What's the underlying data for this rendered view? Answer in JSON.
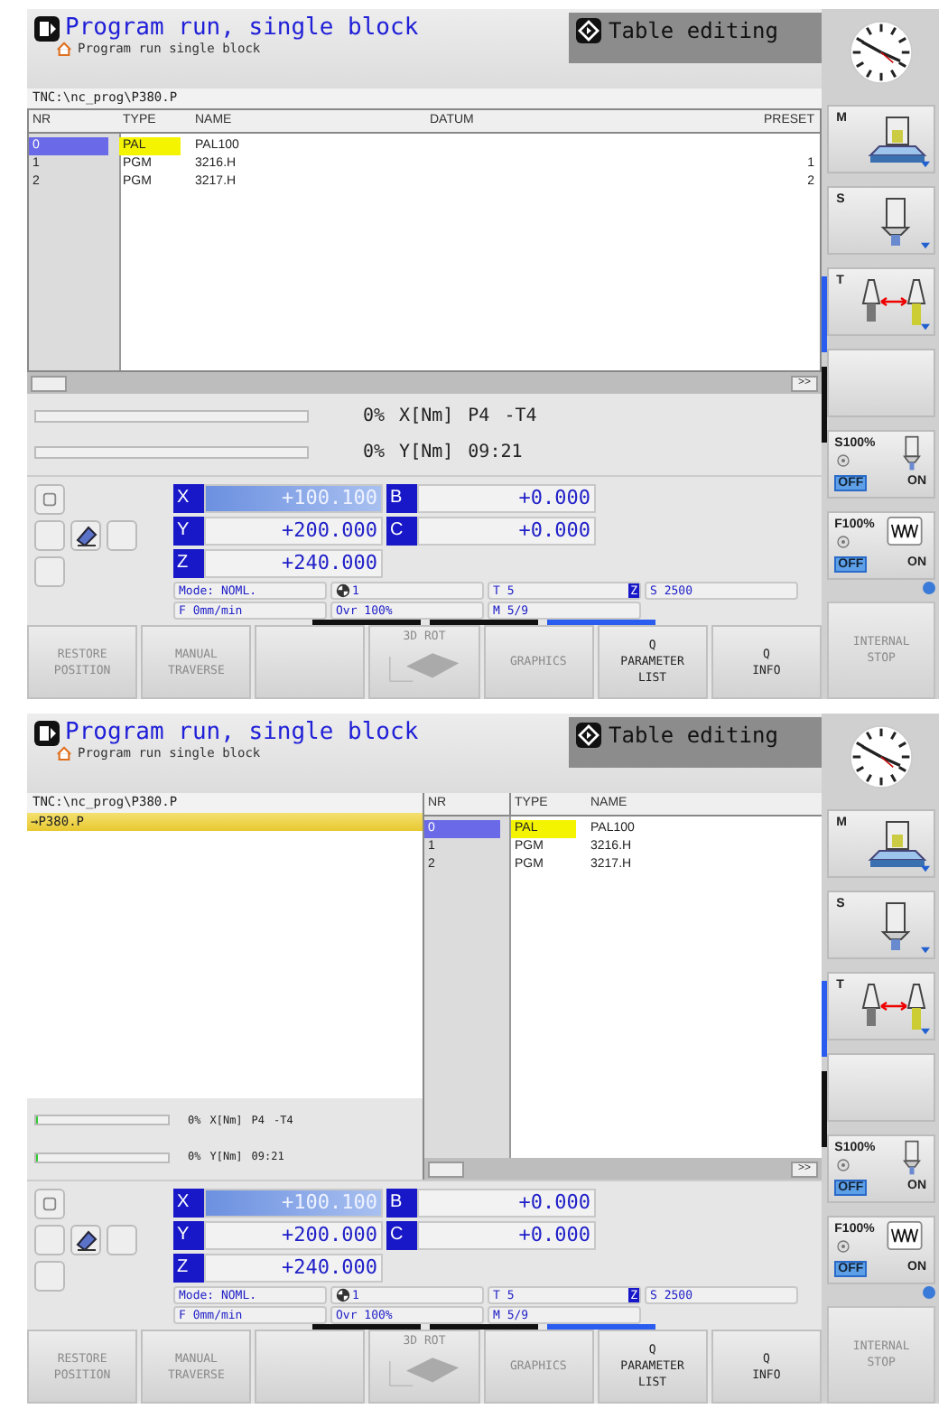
{
  "screens": [
    {
      "kind": "table",
      "header": {
        "title": "Program run, single block",
        "subtitle": "Program run single block",
        "other_mode": "Table editing"
      },
      "path": "TNC:\\nc_prog\\P380.P",
      "table": {
        "columns": [
          "NR",
          "TYPE",
          "NAME",
          "DATUM",
          "PRESET"
        ],
        "rows": [
          {
            "nr": "0",
            "type": "PAL",
            "name": "PAL100",
            "selected": true
          },
          {
            "nr": "1",
            "type": "PGM",
            "name": "3216.H",
            "preset": "1",
            "selected": false
          },
          {
            "nr": "2",
            "type": "PGM",
            "name": "3217.H",
            "preset": "2",
            "selected": false
          }
        ]
      },
      "scroll_button": ">>",
      "meters": [
        {
          "level": 0,
          "texts": [
            "0%",
            "X[Nm]",
            "P4",
            "-T4"
          ]
        },
        {
          "level": 0,
          "texts": [
            "0%",
            "Y[Nm]",
            "09:21"
          ]
        }
      ],
      "axes": [
        {
          "axis": "X",
          "value": "+100.100",
          "selected": true
        },
        {
          "axis": "B",
          "value": "+0.000",
          "selected": false
        },
        {
          "axis": "Y",
          "value": "+200.000",
          "selected": false
        },
        {
          "axis": "C",
          "value": "+0.000",
          "selected": false
        },
        {
          "axis": "Z",
          "value": "+240.000",
          "selected": false
        }
      ],
      "status": {
        "mode": "Mode: NOML.",
        "datum": "1",
        "tool": "T 5",
        "tool_axis": "Z",
        "spindle": "S 2500",
        "feed": "F 0mm/min",
        "override": "Ovr 100%",
        "mfunc": "M 5/9"
      },
      "softkey_pages": [
        {
          "selected": false
        },
        {
          "selected": false
        },
        {
          "selected": true
        }
      ],
      "softkeys": [
        {
          "kind": "text",
          "lines": [
            "RESTORE",
            "POSITION"
          ],
          "disabled": true
        },
        {
          "kind": "text",
          "lines": [
            "MANUAL",
            "TRAVERSE"
          ],
          "disabled": true
        },
        {
          "kind": "blank"
        },
        {
          "kind": "icon",
          "lines": [
            "3D ROT"
          ],
          "disabled": true
        },
        {
          "kind": "text",
          "lines": [
            "GRAPHICS"
          ],
          "disabled": true
        },
        {
          "kind": "text",
          "lines": [
            "Q",
            "PARAMETER",
            "LIST"
          ],
          "disabled": false
        },
        {
          "kind": "text",
          "lines": [
            "Q",
            "INFO"
          ],
          "disabled": false
        }
      ],
      "sidebar": {
        "pages": [
          {
            "selected": true
          },
          {
            "selected": false
          }
        ],
        "buttons": [
          {
            "kind": "machine",
            "letter": "M"
          },
          {
            "kind": "spindle",
            "letter": "S"
          },
          {
            "kind": "tool",
            "letter": "T"
          },
          {
            "kind": "blank"
          }
        ],
        "overrides": [
          {
            "kind": "spindle",
            "label": "S100%",
            "options": [
              {
                "label": "OFF",
                "selected": true
              },
              {
                "label": "ON",
                "selected": false
              }
            ]
          },
          {
            "kind": "feed",
            "label": "F100%",
            "options": [
              {
                "label": "OFF",
                "selected": true
              },
              {
                "label": "ON",
                "selected": false
              }
            ]
          }
        ],
        "stop": {
          "lines": [
            "INTERNAL",
            "STOP"
          ],
          "disabled": true
        }
      }
    },
    {
      "kind": "split",
      "header": {
        "title": "Program run, single block",
        "subtitle": "Program run single block",
        "other_mode": "Table editing"
      },
      "path": "TNC:\\nc_prog\\P380.P",
      "tree": [
        {
          "label": "→P380.P",
          "selected": true
        }
      ],
      "table": {
        "columns": [
          "NR",
          "TYPE",
          "NAME"
        ],
        "rows": [
          {
            "nr": "0",
            "type": "PAL",
            "name": "PAL100",
            "selected": true
          },
          {
            "nr": "1",
            "type": "PGM",
            "name": "3216.H",
            "selected": false
          },
          {
            "nr": "2",
            "type": "PGM",
            "name": "3217.H",
            "selected": false
          }
        ]
      },
      "scroll_button": ">>",
      "meters": [
        {
          "level": 0.02,
          "texts": [
            "0%",
            "X[Nm]",
            "P4",
            "-T4"
          ]
        },
        {
          "level": 0.02,
          "texts": [
            "0%",
            "Y[Nm]",
            "09:21"
          ]
        }
      ],
      "axes": [
        {
          "axis": "X",
          "value": "+100.100",
          "selected": true
        },
        {
          "axis": "B",
          "value": "+0.000",
          "selected": false
        },
        {
          "axis": "Y",
          "value": "+200.000",
          "selected": false
        },
        {
          "axis": "C",
          "value": "+0.000",
          "selected": false
        },
        {
          "axis": "Z",
          "value": "+240.000",
          "selected": false
        }
      ],
      "status": {
        "mode": "Mode: NOML.",
        "datum": "1",
        "tool": "T 5",
        "tool_axis": "Z",
        "spindle": "S 2500",
        "feed": "F 0mm/min",
        "override": "Ovr 100%",
        "mfunc": "M 5/9"
      },
      "softkey_pages": [
        {
          "selected": false
        },
        {
          "selected": false
        },
        {
          "selected": true
        }
      ],
      "softkeys": [
        {
          "kind": "text",
          "lines": [
            "RESTORE",
            "POSITION"
          ],
          "disabled": true
        },
        {
          "kind": "text",
          "lines": [
            "MANUAL",
            "TRAVERSE"
          ],
          "disabled": true
        },
        {
          "kind": "blank"
        },
        {
          "kind": "icon",
          "lines": [
            "3D ROT"
          ],
          "disabled": true
        },
        {
          "kind": "text",
          "lines": [
            "GRAPHICS"
          ],
          "disabled": true
        },
        {
          "kind": "text",
          "lines": [
            "Q",
            "PARAMETER",
            "LIST"
          ],
          "disabled": false
        },
        {
          "kind": "text",
          "lines": [
            "Q",
            "INFO"
          ],
          "disabled": false
        }
      ],
      "sidebar": {
        "pages": [
          {
            "selected": true
          },
          {
            "selected": false
          }
        ],
        "buttons": [
          {
            "kind": "machine",
            "letter": "M"
          },
          {
            "kind": "spindle",
            "letter": "S"
          },
          {
            "kind": "tool",
            "letter": "T"
          },
          {
            "kind": "blank"
          }
        ],
        "overrides": [
          {
            "kind": "spindle",
            "label": "S100%",
            "options": [
              {
                "label": "OFF",
                "selected": true
              },
              {
                "label": "ON",
                "selected": false
              }
            ]
          },
          {
            "kind": "feed",
            "label": "F100%",
            "options": [
              {
                "label": "OFF",
                "selected": true
              },
              {
                "label": "ON",
                "selected": false
              }
            ]
          }
        ],
        "stop": {
          "lines": [
            "INTERNAL",
            "STOP"
          ],
          "disabled": true
        }
      }
    }
  ]
}
